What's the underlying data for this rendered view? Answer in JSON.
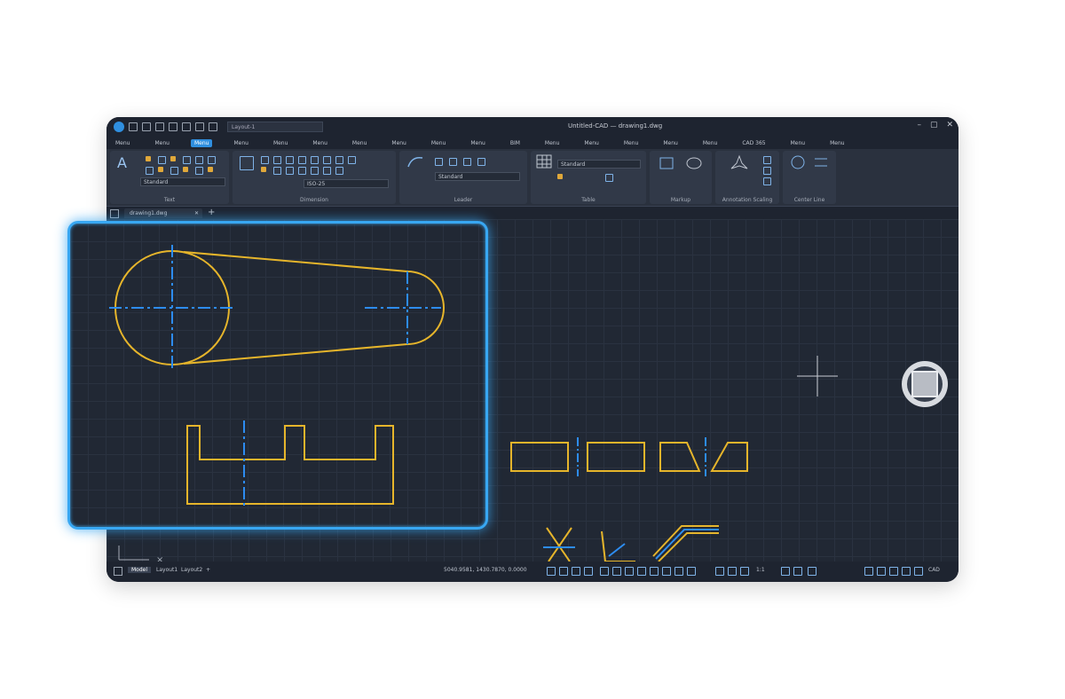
{
  "colors": {
    "accent": "#2f8fe0",
    "geometry": "#e6b52b",
    "centerline": "#2d8cf0",
    "highlight_border": "#38a7f2",
    "canvas": "#212834"
  },
  "app": {
    "title": "Untitled-CAD — drawing1.dwg",
    "workspace": "Layout-1"
  },
  "menubar": {
    "items": [
      "Menu",
      "Menu",
      "Menu",
      "Menu",
      "Menu",
      "Menu",
      "Menu",
      "Menu",
      "Menu",
      "Menu",
      "BIM",
      "Menu",
      "Menu",
      "Menu",
      "Menu",
      "Menu",
      "CAD 365",
      "Menu",
      "Menu"
    ],
    "active_index": 2
  },
  "ribbon": {
    "text_style": "Standard",
    "dim_style": "ISO-25",
    "leader_style": "Standard",
    "table_style": "Standard",
    "panel_labels": [
      "Text",
      "Dimension",
      "Leader",
      "Table",
      "Markup",
      "Annotation Scaling",
      "Center Line"
    ]
  },
  "doc_tab": {
    "label": "drawing1.dwg"
  },
  "status": {
    "model_label": "Model",
    "layout1": "Layout1",
    "layout2": "Layout2",
    "coords": "5040.9581, 1430.7870, 0.0000",
    "scale": "1:1",
    "brand": "CAD"
  },
  "icons": [
    "app-logo-icon",
    "new-icon",
    "open-icon",
    "save-icon",
    "undo-icon",
    "redo-icon",
    "plot-icon",
    "minimize-icon",
    "maximize-icon",
    "close-icon",
    "view-cube-icon",
    "crosshair-icon",
    "ucs-icon",
    "text-icon",
    "dimension-icon",
    "leader-icon",
    "table-icon",
    "markup-icon",
    "annotation-scale-icon",
    "centerline-icon"
  ]
}
